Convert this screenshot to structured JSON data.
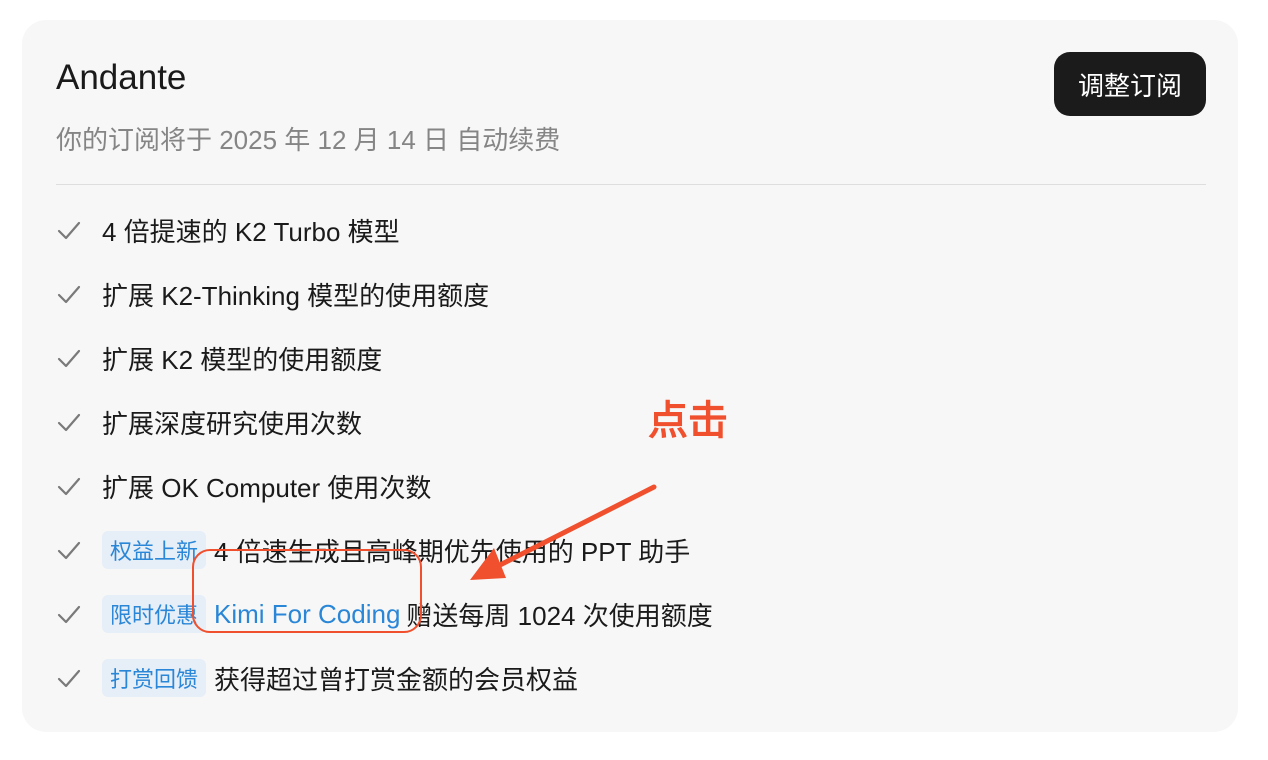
{
  "subscription": {
    "plan_name": "Andante",
    "renewal_text": "你的订阅将于 2025 年 12 月 14 日 自动续费",
    "adjust_button_label": "调整订阅"
  },
  "features": [
    {
      "text": "4 倍提速的 K2 Turbo 模型"
    },
    {
      "text": "扩展 K2-Thinking 模型的使用额度"
    },
    {
      "text": "扩展 K2 模型的使用额度"
    },
    {
      "text": "扩展深度研究使用次数"
    },
    {
      "text": "扩展 OK Computer 使用次数"
    },
    {
      "badge": "权益上新",
      "text": "4 倍速生成且高峰期优先使用的 PPT 助手"
    },
    {
      "badge": "限时优惠",
      "link": "Kimi For Coding",
      "text": "赠送每周 1024 次使用额度"
    },
    {
      "badge": "打赏回馈",
      "text": "获得超过曾打赏金额的会员权益"
    }
  ],
  "annotation": {
    "label": "点击",
    "color": "#f0502d"
  },
  "colors": {
    "card_background": "#f7f7f7",
    "button_background": "#1b1b1b",
    "badge_background": "#e6eef8",
    "accent_blue": "#2a86d6",
    "check_gray": "#7a7a7a"
  },
  "icons": {
    "feature_check": "check-icon",
    "annotation_pointer": "arrow-icon"
  }
}
